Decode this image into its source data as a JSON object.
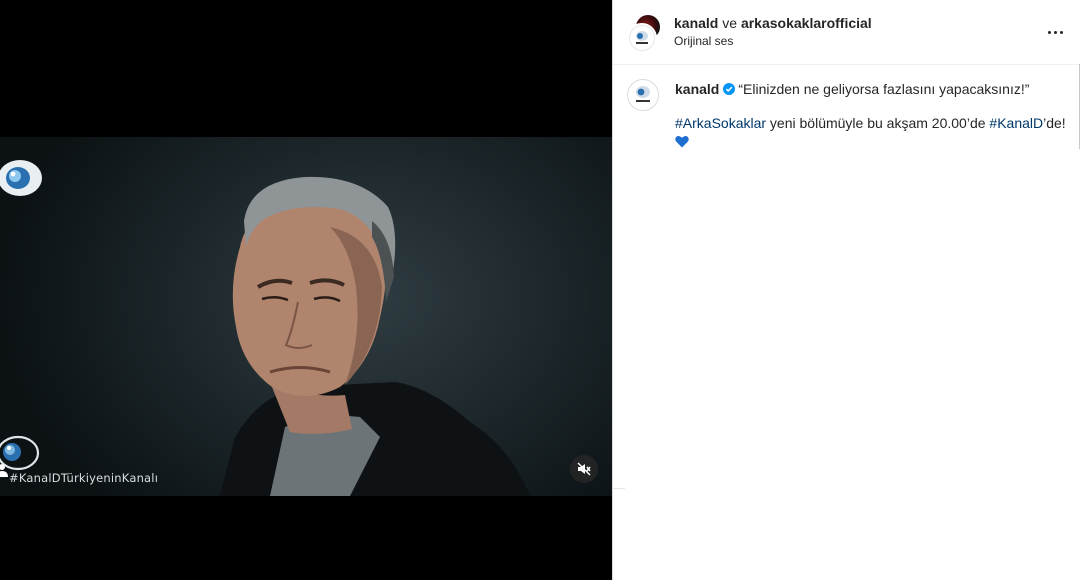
{
  "video": {
    "overlay_hashtag": "#KanalDTürkiyeninKanalı",
    "mute_icon": "speaker-muted-icon",
    "logo_icon": "kanald-eye-logo-icon"
  },
  "header": {
    "account_primary": "kanald",
    "joiner": " ve ",
    "account_secondary": "arkasokaklarofficial",
    "audio_label": "Orijinal ses",
    "more_icon": "more-options-icon"
  },
  "caption": {
    "username": "kanald",
    "verified_icon": "verified-badge-icon",
    "quote": "“Elinizden ne geliyorsa fazlasını yapacaksınız!”",
    "hashtag_1": "#ArkaSokaklar",
    "text_middle": " yeni bölümüyle bu akşam 20.00’de ",
    "hashtag_2": "#KanalD",
    "text_end": "’de!",
    "emoji": "blue-heart-emoji"
  },
  "colors": {
    "link": "#00376b",
    "verified": "#0095f6",
    "heart": "#1f6fd1"
  }
}
